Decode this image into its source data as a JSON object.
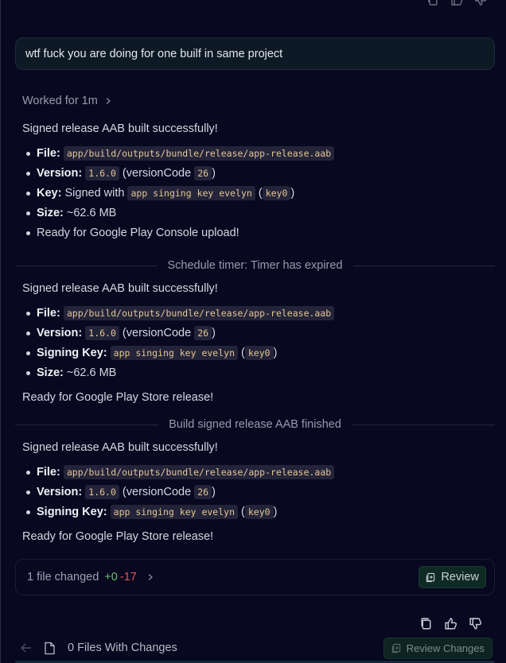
{
  "user_message": "wtf fuck you are doing for one builf in same project",
  "worked_label": "Worked for 1m",
  "blocks": [
    {
      "heading": "Signed release AAB built successfully!",
      "items": [
        {
          "key": "File",
          "code": "app/build/outputs/bundle/release/app-release.aab"
        },
        {
          "key": "Version",
          "code": "1.6.0",
          "mid": "(versionCode",
          "code2": "26",
          "end": ")"
        },
        {
          "key": "Key",
          "pre": "Signed with",
          "code": "app singing key evelyn",
          "mid": "(",
          "code2": "key0",
          "end": ")"
        },
        {
          "key": "Size",
          "text": "~62.6 MB"
        },
        {
          "text": "Ready for Google Play Console upload!"
        }
      ]
    },
    {
      "heading": "Signed release AAB built successfully!",
      "items": [
        {
          "key": "File",
          "code": "app/build/outputs/bundle/release/app-release.aab"
        },
        {
          "key": "Version",
          "code": "1.6.0",
          "mid": "(versionCode",
          "code2": "26",
          "end": ")"
        },
        {
          "key": "Signing Key",
          "code": "app singing key evelyn",
          "mid": "(",
          "code2": "key0",
          "end": ")"
        },
        {
          "key": "Size",
          "text": "~62.6 MB"
        }
      ],
      "after": "Ready for Google Play Store release!"
    },
    {
      "heading": "Signed release AAB built successfully!",
      "items": [
        {
          "key": "File",
          "code": "app/build/outputs/bundle/release/app-release.aab"
        },
        {
          "key": "Version",
          "code": "1.6.0",
          "mid": "(versionCode",
          "code2": "26",
          "end": ")"
        },
        {
          "key": "Signing Key",
          "code": "app singing key evelyn",
          "mid": "(",
          "code2": "key0",
          "end": ")"
        }
      ],
      "after": "Ready for Google Play Store release!"
    }
  ],
  "dividers": [
    "Schedule timer: Timer has expired",
    "Build signed release AAB finished"
  ],
  "changes": {
    "count_label": "1 file changed",
    "added": "+0",
    "removed": "-17",
    "review_label": "Review"
  },
  "footer": {
    "files_label": "0 Files With Changes",
    "review_changes_label": "Review Changes"
  },
  "colors": {
    "background": "#080820",
    "code_text": "#e4c792",
    "added": "#6cc070",
    "removed": "#e0585a"
  },
  "icons": [
    "copy-icon",
    "thumbs-up-icon",
    "thumbs-down-icon",
    "chevron-right-icon",
    "review-icon",
    "back-arrow-icon",
    "file-icon"
  ]
}
